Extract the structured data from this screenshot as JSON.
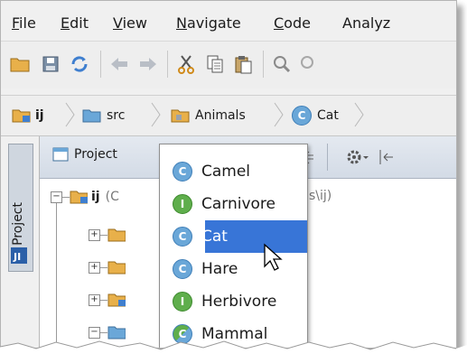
{
  "menubar": {
    "items": [
      {
        "label": "File",
        "underline": "F",
        "rest": "ile"
      },
      {
        "label": "Edit",
        "underline": "E",
        "rest": "dit"
      },
      {
        "label": "View",
        "underline": "V",
        "rest": "iew"
      },
      {
        "label": "Navigate",
        "underline": "N",
        "rest": "avigate"
      },
      {
        "label": "Code",
        "underline": "C",
        "rest": "ode"
      },
      {
        "label": "Analyze",
        "underline": "",
        "rest": "Analyz"
      }
    ]
  },
  "breadcrumb": {
    "items": [
      {
        "label": "ij"
      },
      {
        "label": "src"
      },
      {
        "label": "Animals"
      },
      {
        "label": "Cat"
      }
    ]
  },
  "sidetab": {
    "number": "1",
    "label": ": Project"
  },
  "project_panel": {
    "title": "Project",
    "root_label": "ij",
    "root_detail": "(C",
    "path_fragment": "s\\ij)"
  },
  "popup": {
    "items": [
      {
        "kind": "C",
        "label": "Camel"
      },
      {
        "kind": "I",
        "label": "Carnivore"
      },
      {
        "kind": "C",
        "label": "Cat",
        "selected": true
      },
      {
        "kind": "C",
        "label": "Hare"
      },
      {
        "kind": "I",
        "label": "Herbivore"
      },
      {
        "kind": "C",
        "label": "Mammal"
      }
    ]
  },
  "colors": {
    "selection": "#3875d7",
    "class_badge": "#6aa7d8",
    "interface_badge": "#5fae4c",
    "folder": "#e8b04a"
  }
}
